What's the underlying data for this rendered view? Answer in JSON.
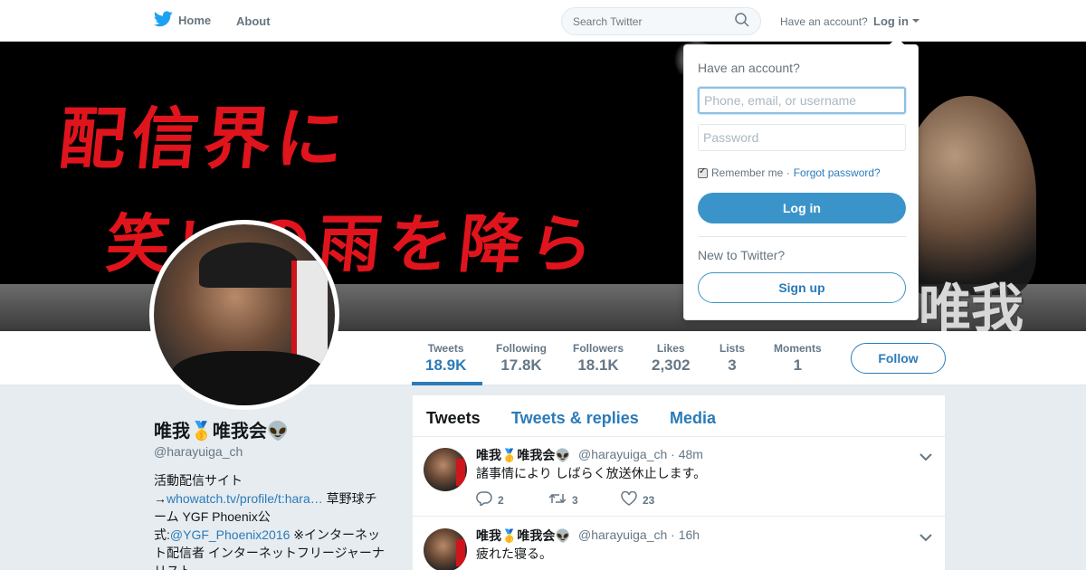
{
  "nav": {
    "home_label": "Home",
    "about_label": "About",
    "search_placeholder": "Search Twitter",
    "have_account": "Have an account?",
    "login_label": "Log in"
  },
  "banner": {
    "line1": "配信界に",
    "line2": "笑いの雨を降ら",
    "name_mark": "唯我"
  },
  "profile": {
    "name": "唯我🥇唯我会👽",
    "handle": "@harayuiga_ch",
    "bio_prefix": "活動配信サイト →",
    "bio_link1": "whowatch.tv/profile/t:hara…",
    "bio_mid": " 草野球チーム YGF Phoenix公式:",
    "bio_link2": "@YGF_Phoenix2016",
    "bio_suffix": " ※インターネット配信者 インターネットフリージャーナリスト"
  },
  "stats": [
    {
      "label": "Tweets",
      "value": "18.9K"
    },
    {
      "label": "Following",
      "value": "17.8K"
    },
    {
      "label": "Followers",
      "value": "18.1K"
    },
    {
      "label": "Likes",
      "value": "2,302"
    },
    {
      "label": "Lists",
      "value": "3"
    },
    {
      "label": "Moments",
      "value": "1"
    }
  ],
  "follow_label": "Follow",
  "timeline": {
    "tabs": [
      "Tweets",
      "Tweets & replies",
      "Media"
    ],
    "tweets": [
      {
        "name": "唯我🥇唯我会👽",
        "handle": "@harayuiga_ch · 48m",
        "text": "諸事情により しばらく放送休止します。",
        "replies": "2",
        "retweets": "3",
        "likes": "23"
      },
      {
        "name": "唯我🥇唯我会👽",
        "handle": "@harayuiga_ch · 16h",
        "text": "疲れた寝る。"
      }
    ]
  },
  "login_dropdown": {
    "heading": "Have an account?",
    "username_placeholder": "Phone, email, or username",
    "password_placeholder": "Password",
    "remember": "Remember me ·",
    "forgot": "Forgot password?",
    "login_button": "Log in",
    "new_heading": "New to Twitter?",
    "signup_button": "Sign up"
  },
  "colors": {
    "accent": "#2b7bb9",
    "button_blue": "#3b94c9",
    "banner_red": "#e0141c"
  }
}
